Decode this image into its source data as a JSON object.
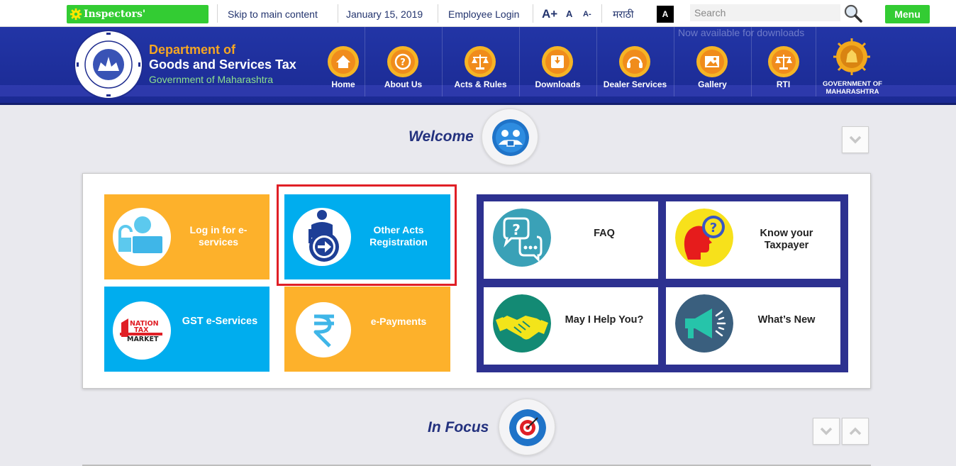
{
  "topbar": {
    "inspectors": "Inspectors'",
    "skip": "Skip to main content",
    "date": "January 15, 2019",
    "employee_login": "Employee Login",
    "font_large": "A+",
    "font_normal": "A",
    "font_small": "A-",
    "language": "मराठी",
    "contrast": "A",
    "search_placeholder": "Search",
    "menu": "Menu"
  },
  "header": {
    "dept_line1": "Department of",
    "dept_line2": "Goods and Services Tax",
    "dept_line3": "Government of Maharashtra",
    "available": "Now available for downloads",
    "nav": [
      {
        "label": "Home",
        "icon": "home-icon"
      },
      {
        "label": "About Us",
        "icon": "question-icon"
      },
      {
        "label": "Acts & Rules",
        "icon": "scales-icon"
      },
      {
        "label": "Downloads",
        "icon": "download-icon"
      },
      {
        "label": "Dealer Services",
        "icon": "headset-icon"
      },
      {
        "label": "Gallery",
        "icon": "gallery-icon"
      },
      {
        "label": "RTI",
        "icon": "scales-icon"
      }
    ],
    "gov_label_1": "GOVERNMENT OF",
    "gov_label_2": "MAHARASHTRA"
  },
  "welcome": {
    "title": "Welcome"
  },
  "tiles": {
    "login": {
      "line1": "Log in for e-",
      "line2": "services"
    },
    "other_acts": {
      "line1": "Other Acts",
      "line2": "Registration"
    },
    "gst": {
      "label": "GST e-Services",
      "logo_1": "NATION",
      "logo_2": "TAX",
      "logo_3": "MARKET"
    },
    "epay": {
      "label": "e-Payments"
    }
  },
  "info_tiles": {
    "faq": "FAQ",
    "know_1": "Know your",
    "know_2": "Taxpayer",
    "help": "May I Help You?",
    "whats_new": "What’s New"
  },
  "in_focus": {
    "title": "In Focus"
  },
  "colors": {
    "green": "#33cc33",
    "navy": "#1f30a0",
    "orange": "#fdb12b",
    "sky": "#00adee",
    "purple": "#2d3190",
    "teal": "#3aa1b7",
    "red_highlight": "#e01f26"
  }
}
